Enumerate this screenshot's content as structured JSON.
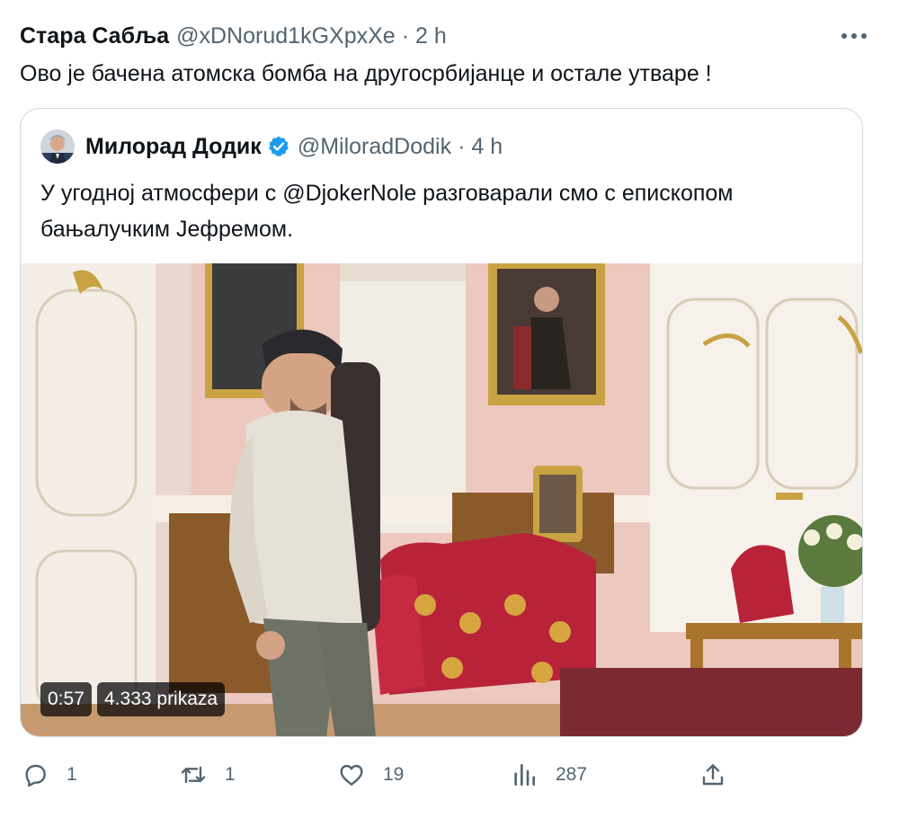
{
  "tweet": {
    "author_name": "Стара Сабља",
    "handle": "@xDNorud1kGXpxXe",
    "separator": "·",
    "time": "2 h",
    "text": "Ово је бачена атомска бомба на другосрбијанце и остале утваре !"
  },
  "quoted": {
    "author_name": "Милорад Додик",
    "handle": "@MiloradDodik",
    "separator": "·",
    "time": "4 h",
    "text_before": "У угодној атмосфери с ",
    "mention": "@DjokerNole",
    "text_after": " разговарали смо с епископом бањалучким Јефремом.",
    "video": {
      "duration": "0:57",
      "views": "4.333 prikaza"
    }
  },
  "actions": {
    "replies": "1",
    "reposts": "1",
    "likes": "19",
    "views": "287"
  },
  "icons": {
    "more": "more-icon",
    "verified": "verified-badge-icon",
    "reply": "reply-icon",
    "repost": "repost-icon",
    "like": "heart-icon",
    "views": "analytics-icon",
    "share": "share-icon"
  },
  "colors": {
    "text": "#0f1419",
    "secondary": "#536471",
    "verified": "#1d9bf0",
    "border": "#cfd9de"
  }
}
